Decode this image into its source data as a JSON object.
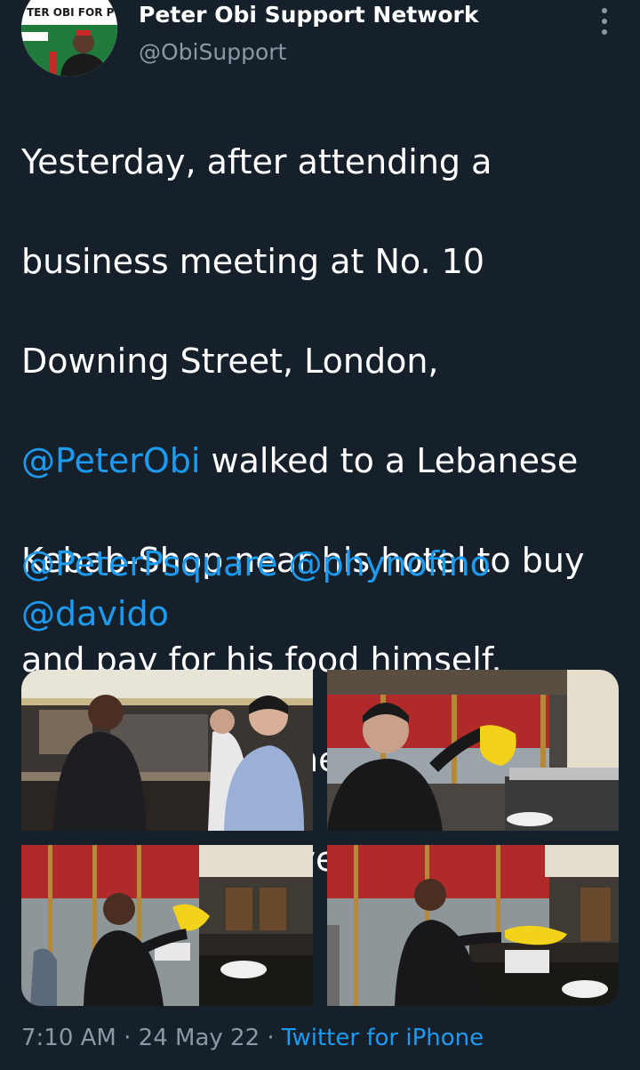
{
  "author": {
    "name": "Peter Obi Support Network",
    "handle": "@ObiSupport",
    "avatar_icon": "profile-avatar",
    "avatar_text": "TER OBI FOR P"
  },
  "tweet": {
    "line1": "Yesterday, after attending a",
    "line2": "business meeting at No. 10",
    "line3": "Downing Street, London,",
    "mention_obi": "@PeterObi",
    "line4_rest": " walked to a Lebanese",
    "line5": "Kebab-Shop near his hotel to buy",
    "line6": "and pay for his food himself.",
    "line7": "No pretensions, he lives a simple",
    "line8": "life like that of every one of us.",
    "mention_psquare": "@PeterPsquare",
    "mention_phyno": "@phynofino",
    "mention_davido": "@davido"
  },
  "meta": {
    "time": "7:10 AM",
    "sep1": " · ",
    "date": "24 May 22",
    "sep2": " · ",
    "source": "Twitter for iPhone"
  },
  "icons": {
    "more": "vertical-ellipsis-icon"
  },
  "colors": {
    "background": "#15202b",
    "link": "#1d9bf0",
    "secondary": "#8b98a5"
  }
}
